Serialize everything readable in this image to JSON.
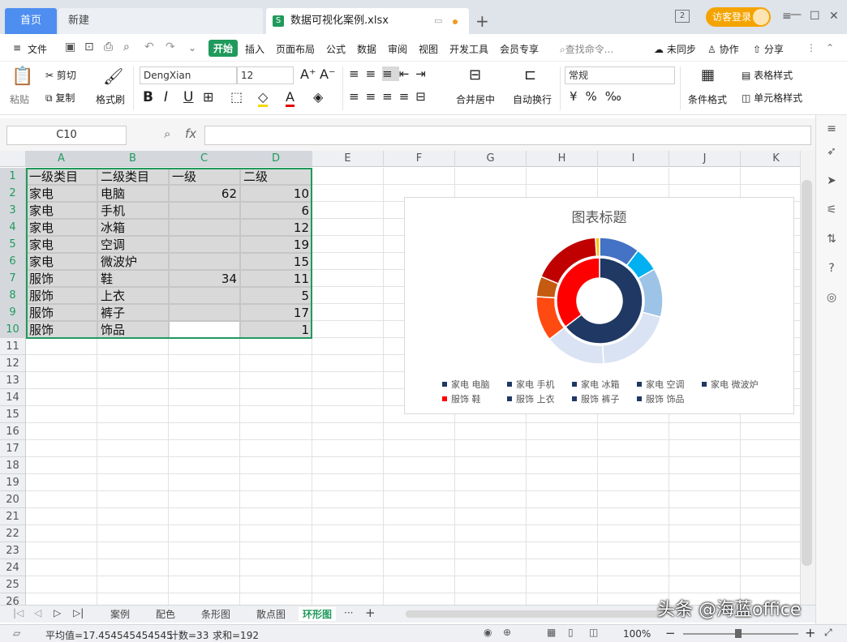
{
  "titlebar": {
    "home_tab": "首页",
    "new_tab": "新建",
    "file_tab": "数据可视化案例.xlsx",
    "file_icon": "S",
    "add": "+",
    "page_badge": "2",
    "login": "访客登录"
  },
  "menu": {
    "file": "文件",
    "items": [
      "开始",
      "插入",
      "页面布局",
      "公式",
      "数据",
      "审阅",
      "视图",
      "开发工具",
      "会员专享"
    ],
    "search": "查找命令...",
    "sync": "未同步",
    "collab": "协作",
    "share": "分享"
  },
  "ribbon": {
    "paste": "粘贴",
    "cut": "剪切",
    "copy": "复制",
    "format_painter": "格式刷",
    "font": "DengXian",
    "size": "12",
    "merge": "合并居中",
    "wrap": "自动换行",
    "number_format": "常规",
    "cond_format": "条件格式",
    "table_style": "表格样式",
    "cell_style": "单元格样式"
  },
  "formula_bar": {
    "name_box": "C10",
    "fx": "fx"
  },
  "columns": [
    "A",
    "B",
    "C",
    "D",
    "E",
    "F",
    "G",
    "H",
    "I",
    "J",
    "K"
  ],
  "rows": [
    "1",
    "2",
    "3",
    "4",
    "5",
    "6",
    "7",
    "8",
    "9",
    "10",
    "11",
    "12",
    "13",
    "14",
    "15",
    "16",
    "17",
    "18",
    "19",
    "20",
    "21",
    "22",
    "23",
    "24",
    "25",
    "26"
  ],
  "table": [
    [
      "一级类目",
      "二级类目",
      "一级",
      "二级"
    ],
    [
      "家电",
      "电脑",
      "62",
      "10"
    ],
    [
      "家电",
      "手机",
      "",
      "6"
    ],
    [
      "家电",
      "冰箱",
      "",
      "12"
    ],
    [
      "家电",
      "空调",
      "",
      "19"
    ],
    [
      "家电",
      "微波炉",
      "",
      "15"
    ],
    [
      "服饰",
      "鞋",
      "34",
      "11"
    ],
    [
      "服饰",
      "上衣",
      "",
      "5"
    ],
    [
      "服饰",
      "裤子",
      "",
      "17"
    ],
    [
      "服饰",
      "饰品",
      "",
      "1"
    ]
  ],
  "chart_data": {
    "type": "doughnut",
    "title": "图表标题",
    "inner_ring": {
      "categories": [
        "家电",
        "服饰"
      ],
      "values": [
        62,
        34
      ],
      "colors": [
        "#1f3864",
        "#ff0000"
      ]
    },
    "outer_ring": {
      "categories": [
        "家电 电脑",
        "家电 手机",
        "家电 冰箱",
        "家电 空调",
        "家电 微波炉",
        "服饰 鞋",
        "服饰 上衣",
        "服饰 裤子",
        "服饰 饰品"
      ],
      "values": [
        10,
        6,
        12,
        19,
        15,
        11,
        5,
        17,
        1
      ],
      "colors": [
        "#4472c4",
        "#00b0f0",
        "#9dc3e6",
        "#dae3f3",
        "#dae3f3",
        "#ff4b12",
        "#c55a11",
        "#c00000",
        "#ffc000"
      ]
    },
    "legend": [
      {
        "label": "家电 电脑",
        "color": "#1f3864"
      },
      {
        "label": "家电 手机",
        "color": "#1f3864"
      },
      {
        "label": "家电 冰箱",
        "color": "#1f3864"
      },
      {
        "label": "家电 空调",
        "color": "#1f3864"
      },
      {
        "label": "家电 微波炉",
        "color": "#1f3864"
      },
      {
        "label": "服饰 鞋",
        "color": "#ff0000"
      },
      {
        "label": "服饰 上衣",
        "color": "#1f3864"
      },
      {
        "label": "服饰 裤子",
        "color": "#1f3864"
      },
      {
        "label": "服饰 饰品",
        "color": "#1f3864"
      }
    ],
    "legend_position": "bottom"
  },
  "sheets": [
    "案例",
    "配色",
    "条形图",
    "散点图",
    "环形图"
  ],
  "active_sheet": "环形图",
  "status": {
    "average": "平均值=17.454545454545",
    "count": "计数=33",
    "sum": "求和=192",
    "zoom": "100%"
  },
  "watermark": "头条 @海蓝office"
}
